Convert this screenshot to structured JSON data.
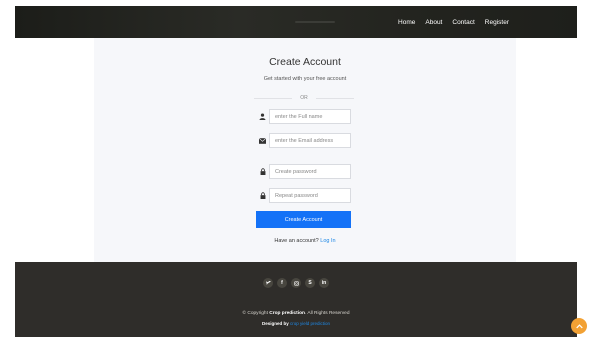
{
  "nav": {
    "links": [
      "Home",
      "About",
      "Contact",
      "Register"
    ]
  },
  "form": {
    "title": "Create Account",
    "subtitle": "Get started with your free account",
    "divider": "OR",
    "full_name_placeholder": "enter the Full name",
    "email_placeholder": "enter the Email address",
    "password_placeholder": "Create password",
    "repeat_password_placeholder": "Repeat password",
    "submit_label": "Create Account",
    "have_account": "Have an account?",
    "login_link": "Log In"
  },
  "footer": {
    "social": [
      {
        "icon": "twitter-icon",
        "glyph": "🐦"
      },
      {
        "icon": "facebook-icon",
        "glyph": "f"
      },
      {
        "icon": "instagram-icon",
        "glyph": "◎"
      },
      {
        "icon": "skype-icon",
        "glyph": "S"
      },
      {
        "icon": "linkedin-icon",
        "glyph": "in"
      }
    ],
    "copyright_prefix": "© Copyright",
    "copyright_brand": "Crop prediction",
    "copyright_suffix": ". All Rights Reserved",
    "designed_by_label": "Designed by",
    "designed_by_link": "crop yield prediction"
  },
  "colors": {
    "accent": "#1472f7",
    "back_to_top": "#f2a134"
  }
}
